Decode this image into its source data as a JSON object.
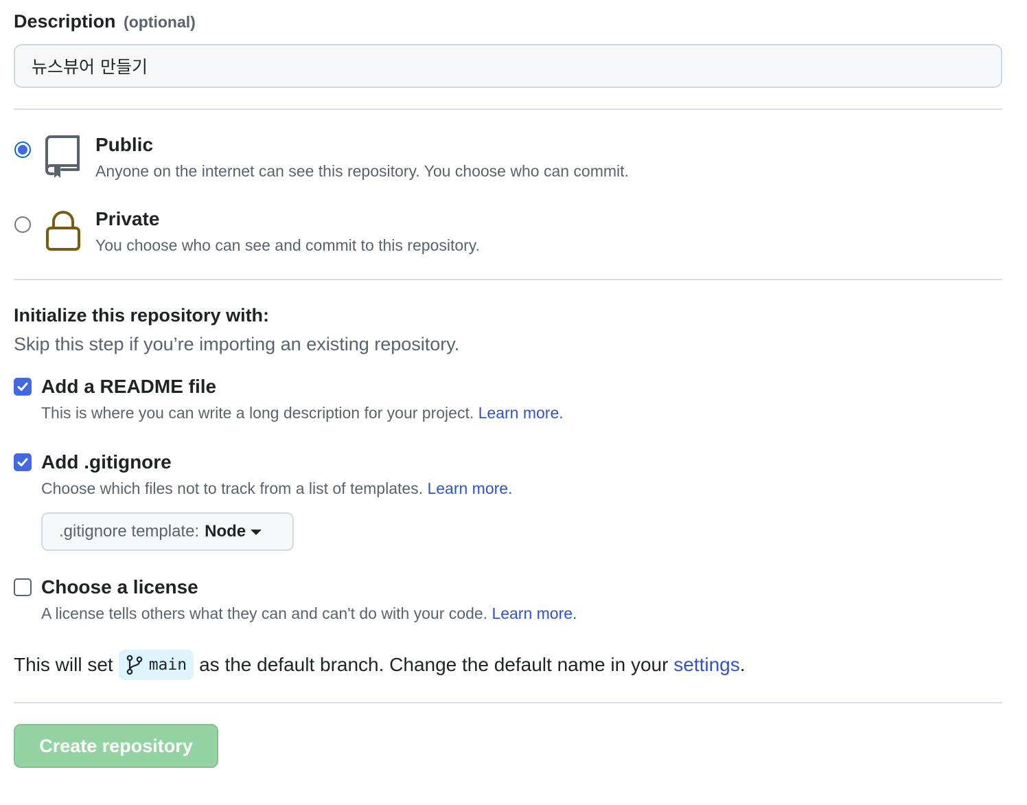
{
  "description": {
    "label": "Description",
    "optional": "(optional)",
    "value": "뉴스뷰어 만들기"
  },
  "visibility": {
    "selected": "public",
    "options": [
      {
        "title": "Public",
        "desc": "Anyone on the internet can see this repository. You choose who can commit.",
        "icon": "repo-icon"
      },
      {
        "title": "Private",
        "desc": "You choose who can see and commit to this repository.",
        "icon": "lock-icon"
      }
    ]
  },
  "init": {
    "title": "Initialize this repository with:",
    "subtitle": "Skip this step if you’re importing an existing repository.",
    "readme": {
      "label": "Add a README file",
      "desc": "This is where you can write a long description for your project.",
      "link": "Learn more.",
      "checked": true
    },
    "gitignore": {
      "label": "Add .gitignore",
      "desc": "Choose which files not to track from a list of templates.",
      "link": "Learn more.",
      "checked": true
    },
    "template": {
      "label": ".gitignore template:",
      "value": "Node"
    },
    "license": {
      "label": "Choose a license",
      "desc": "A license tells others what they can and can't do with your code.",
      "link": "Learn more.",
      "checked": false
    }
  },
  "branch": {
    "prefix": "This will set",
    "name": "main",
    "middle": "as the default branch. Change the default name in your",
    "link": "settings",
    "suffix": "."
  },
  "create_button": "Create repository",
  "colors": {
    "accent": "#4169e1",
    "link": "#2f52d0",
    "lock": "#7d5a12",
    "create_disabled": "#94d3a2"
  }
}
